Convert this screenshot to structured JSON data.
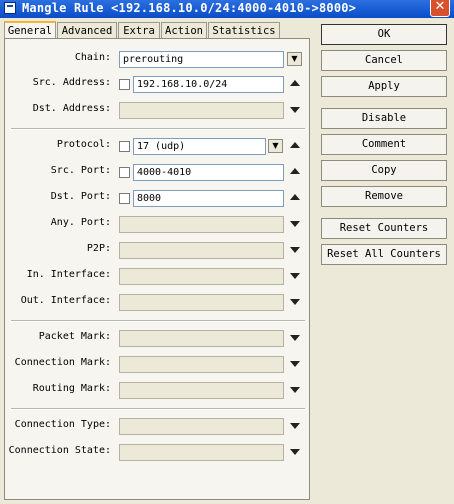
{
  "window": {
    "title": "Mangle Rule <192.168.10.0/24:4000-4010->8000>",
    "close_glyph": "✕"
  },
  "tabs": [
    {
      "label": "General",
      "active": true
    },
    {
      "label": "Advanced"
    },
    {
      "label": "Extra"
    },
    {
      "label": "Action"
    },
    {
      "label": "Statistics"
    }
  ],
  "fields": {
    "chain": {
      "label": "Chain:",
      "value": "prerouting"
    },
    "src_address": {
      "label": "Src. Address:",
      "value": "192.168.10.0/24"
    },
    "dst_address": {
      "label": "Dst. Address:",
      "value": ""
    },
    "protocol": {
      "label": "Protocol:",
      "value": "17 (udp)"
    },
    "src_port": {
      "label": "Src. Port:",
      "value": "4000-4010"
    },
    "dst_port": {
      "label": "Dst. Port:",
      "value": "8000"
    },
    "any_port": {
      "label": "Any. Port:",
      "value": ""
    },
    "p2p": {
      "label": "P2P:",
      "value": ""
    },
    "in_interface": {
      "label": "In. Interface:",
      "value": ""
    },
    "out_interface": {
      "label": "Out. Interface:",
      "value": ""
    },
    "packet_mark": {
      "label": "Packet Mark:",
      "value": ""
    },
    "connection_mark": {
      "label": "Connection Mark:",
      "value": ""
    },
    "routing_mark": {
      "label": "Routing Mark:",
      "value": ""
    },
    "connection_type": {
      "label": "Connection Type:",
      "value": ""
    },
    "connection_state": {
      "label": "Connection State:",
      "value": ""
    }
  },
  "buttons": {
    "ok": "OK",
    "cancel": "Cancel",
    "apply": "Apply",
    "disable": "Disable",
    "comment": "Comment",
    "copy": "Copy",
    "remove": "Remove",
    "reset_counters": "Reset Counters",
    "reset_all_counters": "Reset All Counters"
  },
  "icons": {
    "dropdown": "dropdown-arrow-icon",
    "expand_down": "triangle-down-icon",
    "collapse_up": "triangle-up-icon"
  },
  "colors": {
    "titlebar": "#0b4cc7",
    "active_tab_accent": "#f0b53c",
    "close_button": "#d9502d"
  }
}
